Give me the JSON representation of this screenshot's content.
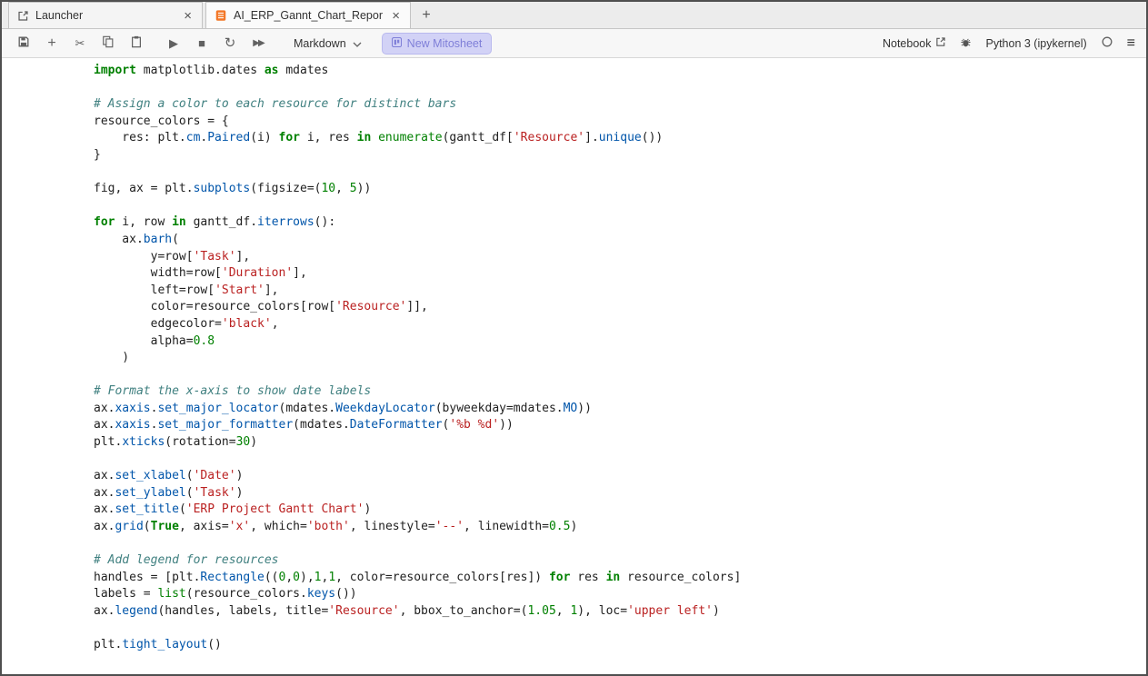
{
  "tabbar": {
    "tabs": [
      {
        "label": "Launcher",
        "close": "×"
      },
      {
        "label": "AI_ERP_Gannt_Chart_Repor",
        "close": "×"
      }
    ],
    "add_label": "+"
  },
  "toolbar": {
    "cell_type": "Markdown",
    "mitosheet_label": "New Mitosheet",
    "notebook_label": "Notebook",
    "kernel_name": "Python 3 (ipykernel)",
    "glyphs": {
      "add": "+",
      "cut": "✂",
      "run": "▶",
      "stop": "■",
      "restart": "↻",
      "run_all": "▶▶",
      "menu": "≡"
    }
  },
  "code": {
    "lines": [
      [
        [
          "kw",
          "import"
        ],
        [
          "pl",
          " matplotlib.dates "
        ],
        [
          "kw",
          "as"
        ],
        [
          "pl",
          " mdates"
        ]
      ],
      [],
      [
        [
          "cm",
          "# Assign a color to each resource for distinct bars"
        ]
      ],
      [
        [
          "pl",
          "resource_colors = {"
        ]
      ],
      [
        [
          "pl",
          "    res: plt."
        ],
        [
          "pr",
          "cm"
        ],
        [
          "pl",
          "."
        ],
        [
          "pr",
          "Paired"
        ],
        [
          "pl",
          "(i) "
        ],
        [
          "kw",
          "for"
        ],
        [
          "pl",
          " i, res "
        ],
        [
          "kw",
          "in"
        ],
        [
          "pl",
          " "
        ],
        [
          "bi",
          "enumerate"
        ],
        [
          "pl",
          "(gantt_df["
        ],
        [
          "st",
          "'Resource'"
        ],
        [
          "pl",
          "]."
        ],
        [
          "pr",
          "unique"
        ],
        [
          "pl",
          "())"
        ]
      ],
      [
        [
          "pl",
          "}"
        ]
      ],
      [],
      [
        [
          "pl",
          "fig, ax = plt."
        ],
        [
          "pr",
          "subplots"
        ],
        [
          "pl",
          "(figsize=("
        ],
        [
          "nu",
          "10"
        ],
        [
          "pl",
          ", "
        ],
        [
          "nu",
          "5"
        ],
        [
          "pl",
          "))"
        ]
      ],
      [],
      [
        [
          "kw",
          "for"
        ],
        [
          "pl",
          " i, row "
        ],
        [
          "kw",
          "in"
        ],
        [
          "pl",
          " gantt_df."
        ],
        [
          "pr",
          "iterrows"
        ],
        [
          "pl",
          "():"
        ]
      ],
      [
        [
          "pl",
          "    ax."
        ],
        [
          "pr",
          "barh"
        ],
        [
          "pl",
          "("
        ]
      ],
      [
        [
          "pl",
          "        y=row["
        ],
        [
          "st",
          "'Task'"
        ],
        [
          "pl",
          "],"
        ]
      ],
      [
        [
          "pl",
          "        width=row["
        ],
        [
          "st",
          "'Duration'"
        ],
        [
          "pl",
          "],"
        ]
      ],
      [
        [
          "pl",
          "        left=row["
        ],
        [
          "st",
          "'Start'"
        ],
        [
          "pl",
          "],"
        ]
      ],
      [
        [
          "pl",
          "        color=resource_colors[row["
        ],
        [
          "st",
          "'Resource'"
        ],
        [
          "pl",
          "]],"
        ]
      ],
      [
        [
          "pl",
          "        edgecolor="
        ],
        [
          "st",
          "'black'"
        ],
        [
          "pl",
          ","
        ]
      ],
      [
        [
          "pl",
          "        alpha="
        ],
        [
          "nu",
          "0.8"
        ]
      ],
      [
        [
          "pl",
          "    )"
        ]
      ],
      [],
      [
        [
          "cm",
          "# Format the x-axis to show date labels"
        ]
      ],
      [
        [
          "pl",
          "ax."
        ],
        [
          "pr",
          "xaxis"
        ],
        [
          "pl",
          "."
        ],
        [
          "pr",
          "set_major_locator"
        ],
        [
          "pl",
          "(mdates."
        ],
        [
          "pr",
          "WeekdayLocator"
        ],
        [
          "pl",
          "(byweekday=mdates."
        ],
        [
          "pr",
          "MO"
        ],
        [
          "pl",
          "))"
        ]
      ],
      [
        [
          "pl",
          "ax."
        ],
        [
          "pr",
          "xaxis"
        ],
        [
          "pl",
          "."
        ],
        [
          "pr",
          "set_major_formatter"
        ],
        [
          "pl",
          "(mdates."
        ],
        [
          "pr",
          "DateFormatter"
        ],
        [
          "pl",
          "("
        ],
        [
          "st",
          "'%b %d'"
        ],
        [
          "pl",
          "))"
        ]
      ],
      [
        [
          "pl",
          "plt."
        ],
        [
          "pr",
          "xticks"
        ],
        [
          "pl",
          "(rotation="
        ],
        [
          "nu",
          "30"
        ],
        [
          "pl",
          ")"
        ]
      ],
      [],
      [
        [
          "pl",
          "ax."
        ],
        [
          "pr",
          "set_xlabel"
        ],
        [
          "pl",
          "("
        ],
        [
          "st",
          "'Date'"
        ],
        [
          "pl",
          ")"
        ]
      ],
      [
        [
          "pl",
          "ax."
        ],
        [
          "pr",
          "set_ylabel"
        ],
        [
          "pl",
          "("
        ],
        [
          "st",
          "'Task'"
        ],
        [
          "pl",
          ")"
        ]
      ],
      [
        [
          "pl",
          "ax."
        ],
        [
          "pr",
          "set_title"
        ],
        [
          "pl",
          "("
        ],
        [
          "st",
          "'ERP Project Gantt Chart'"
        ],
        [
          "pl",
          ")"
        ]
      ],
      [
        [
          "pl",
          "ax."
        ],
        [
          "pr",
          "grid"
        ],
        [
          "pl",
          "("
        ],
        [
          "kw",
          "True"
        ],
        [
          "pl",
          ", axis="
        ],
        [
          "st",
          "'x'"
        ],
        [
          "pl",
          ", which="
        ],
        [
          "st",
          "'both'"
        ],
        [
          "pl",
          ", linestyle="
        ],
        [
          "st",
          "'--'"
        ],
        [
          "pl",
          ", linewidth="
        ],
        [
          "nu",
          "0.5"
        ],
        [
          "pl",
          ")"
        ]
      ],
      [],
      [
        [
          "cm",
          "# Add legend for resources"
        ]
      ],
      [
        [
          "pl",
          "handles = [plt."
        ],
        [
          "pr",
          "Rectangle"
        ],
        [
          "pl",
          "(("
        ],
        [
          "nu",
          "0"
        ],
        [
          "pl",
          ","
        ],
        [
          "nu",
          "0"
        ],
        [
          "pl",
          "),"
        ],
        [
          "nu",
          "1"
        ],
        [
          "pl",
          ","
        ],
        [
          "nu",
          "1"
        ],
        [
          "pl",
          ", color=resource_colors[res]) "
        ],
        [
          "kw",
          "for"
        ],
        [
          "pl",
          " res "
        ],
        [
          "kw",
          "in"
        ],
        [
          "pl",
          " resource_colors]"
        ]
      ],
      [
        [
          "pl",
          "labels = "
        ],
        [
          "bi",
          "list"
        ],
        [
          "pl",
          "(resource_colors."
        ],
        [
          "pr",
          "keys"
        ],
        [
          "pl",
          "())"
        ]
      ],
      [
        [
          "pl",
          "ax."
        ],
        [
          "pr",
          "legend"
        ],
        [
          "pl",
          "(handles, labels, title="
        ],
        [
          "st",
          "'Resource'"
        ],
        [
          "pl",
          ", bbox_to_anchor=("
        ],
        [
          "nu",
          "1.05"
        ],
        [
          "pl",
          ", "
        ],
        [
          "nu",
          "1"
        ],
        [
          "pl",
          "), loc="
        ],
        [
          "st",
          "'upper left'"
        ],
        [
          "pl",
          ")"
        ]
      ],
      [],
      [
        [
          "pl",
          "plt."
        ],
        [
          "pr",
          "tight_layout"
        ],
        [
          "pl",
          "()"
        ]
      ]
    ]
  }
}
